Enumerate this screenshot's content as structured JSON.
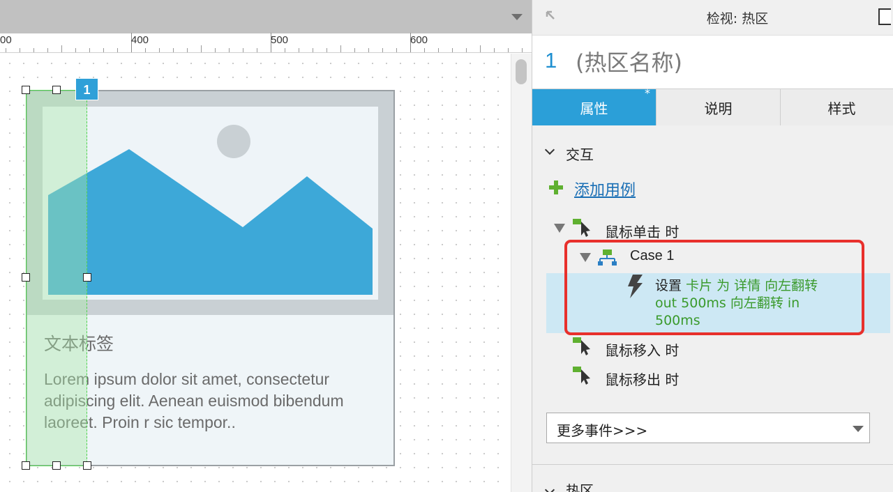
{
  "ruler": {
    "labels": [
      "00",
      "400",
      "500",
      "600"
    ]
  },
  "canvas": {
    "card": {
      "title": "文本标签",
      "body": "Lorem ipsum dolor sit amet, consectetur adipiscing elit. Aenean euismod bibendum laoreet. Proin r sic tempor.."
    },
    "hotspot_number": "1"
  },
  "inspector": {
    "title": "检视: 热区",
    "widget_number": "1",
    "widget_name": "(热区名称)",
    "tabs": [
      {
        "label": "属性",
        "mark": "*"
      },
      {
        "label": "说明"
      },
      {
        "label": "样式"
      }
    ],
    "interaction_section": "交互",
    "add_case": "添加用例",
    "events": [
      {
        "label": "鼠标单击 时"
      },
      {
        "label": "鼠标移入 时"
      },
      {
        "label": "鼠标移出 时"
      }
    ],
    "case": {
      "label": "Case 1",
      "action_prefix": "设置 ",
      "action_detail_1": "卡片 为 详情 向左翻转",
      "action_detail_2": "out 500ms 向左翻转 in",
      "action_detail_3": "500ms"
    },
    "more_events": "更多事件>>>",
    "hotspot_section": "热区"
  },
  "colors": {
    "accent_blue": "#2b9fd8",
    "action_green": "#3a9a2c",
    "highlight_red": "#e8302c",
    "hotspot_green": "#4fd24f"
  }
}
